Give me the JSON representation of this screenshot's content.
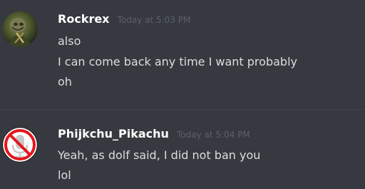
{
  "messages": [
    {
      "author": "Rockrex",
      "timestamp": "Today at 5:03 PM",
      "lines": [
        "also",
        "I can come back any time I want probably",
        "oh"
      ]
    },
    {
      "author": "Phijkchu_Pikachu",
      "timestamp": "Today at 5:04 PM",
      "lines": [
        "Yeah, as dolf said, I did not ban you",
        "lol"
      ]
    }
  ],
  "colors": {
    "background": "#36393f",
    "username": "#ffffff",
    "message_text": "#dcddde",
    "timestamp": "#5c6168",
    "no_symbol_red": "#e4171d"
  },
  "icons": {
    "avatar_1": "portrait-avatar",
    "avatar_2": "no-microphone-icon"
  }
}
